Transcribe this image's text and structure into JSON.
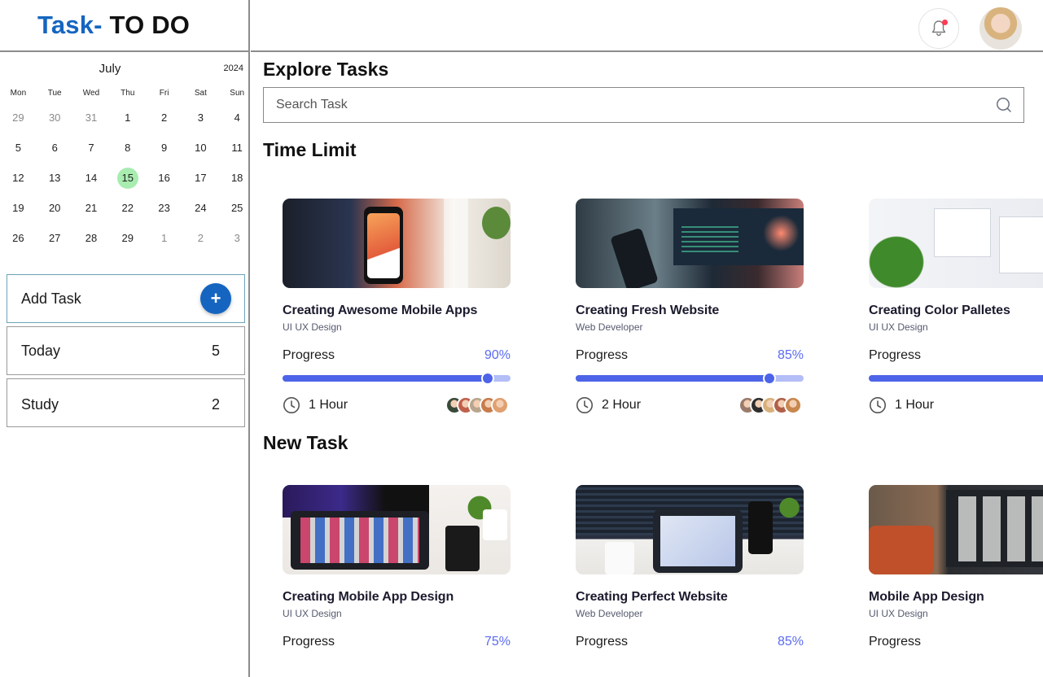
{
  "app": {
    "logo_accent": "Task-",
    "logo_rest": " TO DO",
    "accent_color": "#1565c0"
  },
  "calendar": {
    "month": "July",
    "year": "2024",
    "weekdays": [
      "Mon",
      "Tue",
      "Wed",
      "Thu",
      "Fri",
      "Sat",
      "Sun"
    ],
    "selected_day": "15",
    "weeks": [
      [
        {
          "d": "29",
          "m": true
        },
        {
          "d": "30",
          "m": true
        },
        {
          "d": "31",
          "m": true
        },
        {
          "d": "1"
        },
        {
          "d": "2"
        },
        {
          "d": "3"
        },
        {
          "d": "4"
        }
      ],
      [
        {
          "d": "5"
        },
        {
          "d": "6"
        },
        {
          "d": "7"
        },
        {
          "d": "8"
        },
        {
          "d": "9"
        },
        {
          "d": "10"
        },
        {
          "d": "11"
        }
      ],
      [
        {
          "d": "12"
        },
        {
          "d": "13"
        },
        {
          "d": "14"
        },
        {
          "d": "15",
          "t": true
        },
        {
          "d": "16"
        },
        {
          "d": "17"
        },
        {
          "d": "18"
        }
      ],
      [
        {
          "d": "19"
        },
        {
          "d": "20"
        },
        {
          "d": "21"
        },
        {
          "d": "22"
        },
        {
          "d": "23"
        },
        {
          "d": "24"
        },
        {
          "d": "25"
        }
      ],
      [
        {
          "d": "26"
        },
        {
          "d": "27"
        },
        {
          "d": "28"
        },
        {
          "d": "29"
        },
        {
          "d": "1",
          "m": true
        },
        {
          "d": "2",
          "m": true
        },
        {
          "d": "3",
          "m": true
        }
      ]
    ]
  },
  "sidebar": {
    "add_task_label": "Add Task",
    "add_icon": "+",
    "lists": [
      {
        "label": "Today",
        "count": "5"
      },
      {
        "label": "Study",
        "count": "2"
      }
    ]
  },
  "header": {
    "bell_icon": "bell-icon",
    "has_notification": true
  },
  "main": {
    "explore_title": "Explore Tasks",
    "search_placeholder": "Search Task",
    "time_limit_title": "Time Limit",
    "new_task_title": "New Task",
    "progress_label": "Progress",
    "time_limit_cards": [
      {
        "title": "Creating Awesome Mobile Apps",
        "subtitle": "UI UX Design",
        "progress_text": "90%",
        "progress": 0.9,
        "time": "1 Hour",
        "avatars": [
          "#3a4a3a",
          "#c0604a",
          "#b9a58e",
          "#c97b4a",
          "#e0a070"
        ]
      },
      {
        "title": "Creating Fresh Website",
        "subtitle": "Web Developer",
        "progress_text": "85%",
        "progress": 0.85,
        "time": "2 Hour",
        "avatars": [
          "#9a7a6a",
          "#2e2e2e",
          "#d8b07a",
          "#b0604a",
          "#c8874e"
        ]
      },
      {
        "title": "Creating Color Palletes",
        "subtitle": "UI UX Design",
        "progress_text": "",
        "progress": 1.0,
        "time": "1 Hour",
        "avatars": [
          "#3a4a3a"
        ]
      }
    ],
    "new_task_cards": [
      {
        "title": "Creating Mobile App Design",
        "subtitle": "UI UX Design",
        "progress_text": "75%"
      },
      {
        "title": "Creating Perfect Website",
        "subtitle": "Web Developer",
        "progress_text": "85%"
      },
      {
        "title": "Mobile App Design",
        "subtitle": "UI UX Design",
        "progress_text": ""
      }
    ]
  }
}
